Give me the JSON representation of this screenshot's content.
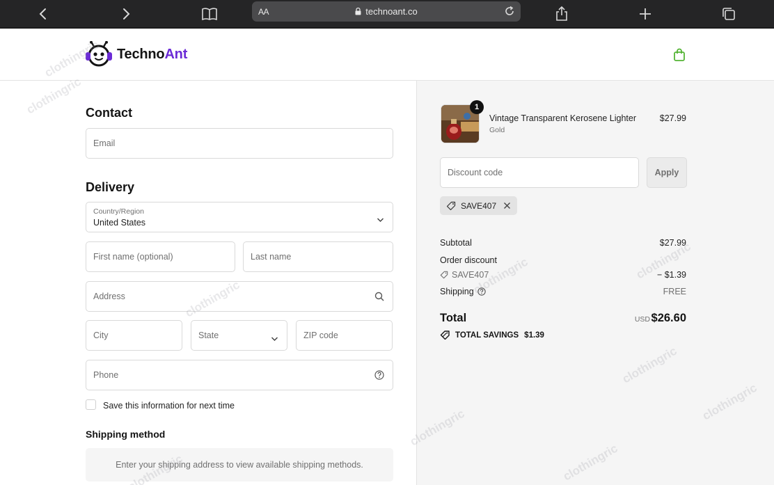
{
  "browser": {
    "text_size_label": "AA",
    "url": "technoant.co"
  },
  "header": {
    "logo_text_part1": "Techno",
    "logo_text_part2": "Ant",
    "accent_color": "#6b2bd6",
    "cart_color": "#54b435"
  },
  "contact": {
    "title": "Contact",
    "email_placeholder": "Email"
  },
  "delivery": {
    "title": "Delivery",
    "country_label": "Country/Region",
    "country_value": "United States",
    "first_name_placeholder": "First name (optional)",
    "last_name_placeholder": "Last name",
    "address_placeholder": "Address",
    "city_placeholder": "City",
    "state_placeholder": "State",
    "zip_placeholder": "ZIP code",
    "phone_placeholder": "Phone",
    "save_info_label": "Save this information for next time"
  },
  "shipping_method": {
    "title": "Shipping method",
    "info": "Enter your shipping address to view available shipping methods."
  },
  "summary": {
    "item": {
      "quantity": "1",
      "name": "Vintage Transparent Kerosene Lighter",
      "variant": "Gold",
      "price": "$27.99"
    },
    "discount_placeholder": "Discount code",
    "apply_label": "Apply",
    "applied_code": "SAVE407",
    "subtotal_label": "Subtotal",
    "subtotal_value": "$27.99",
    "order_discount_label": "Order discount",
    "order_discount_code": "SAVE407",
    "order_discount_value": "− $1.39",
    "shipping_label": "Shipping",
    "shipping_value": "FREE",
    "total_label": "Total",
    "total_currency": "USD",
    "total_value": "$26.60",
    "savings_label": "TOTAL SAVINGS",
    "savings_value": "$1.39"
  },
  "watermark": "clothingric"
}
